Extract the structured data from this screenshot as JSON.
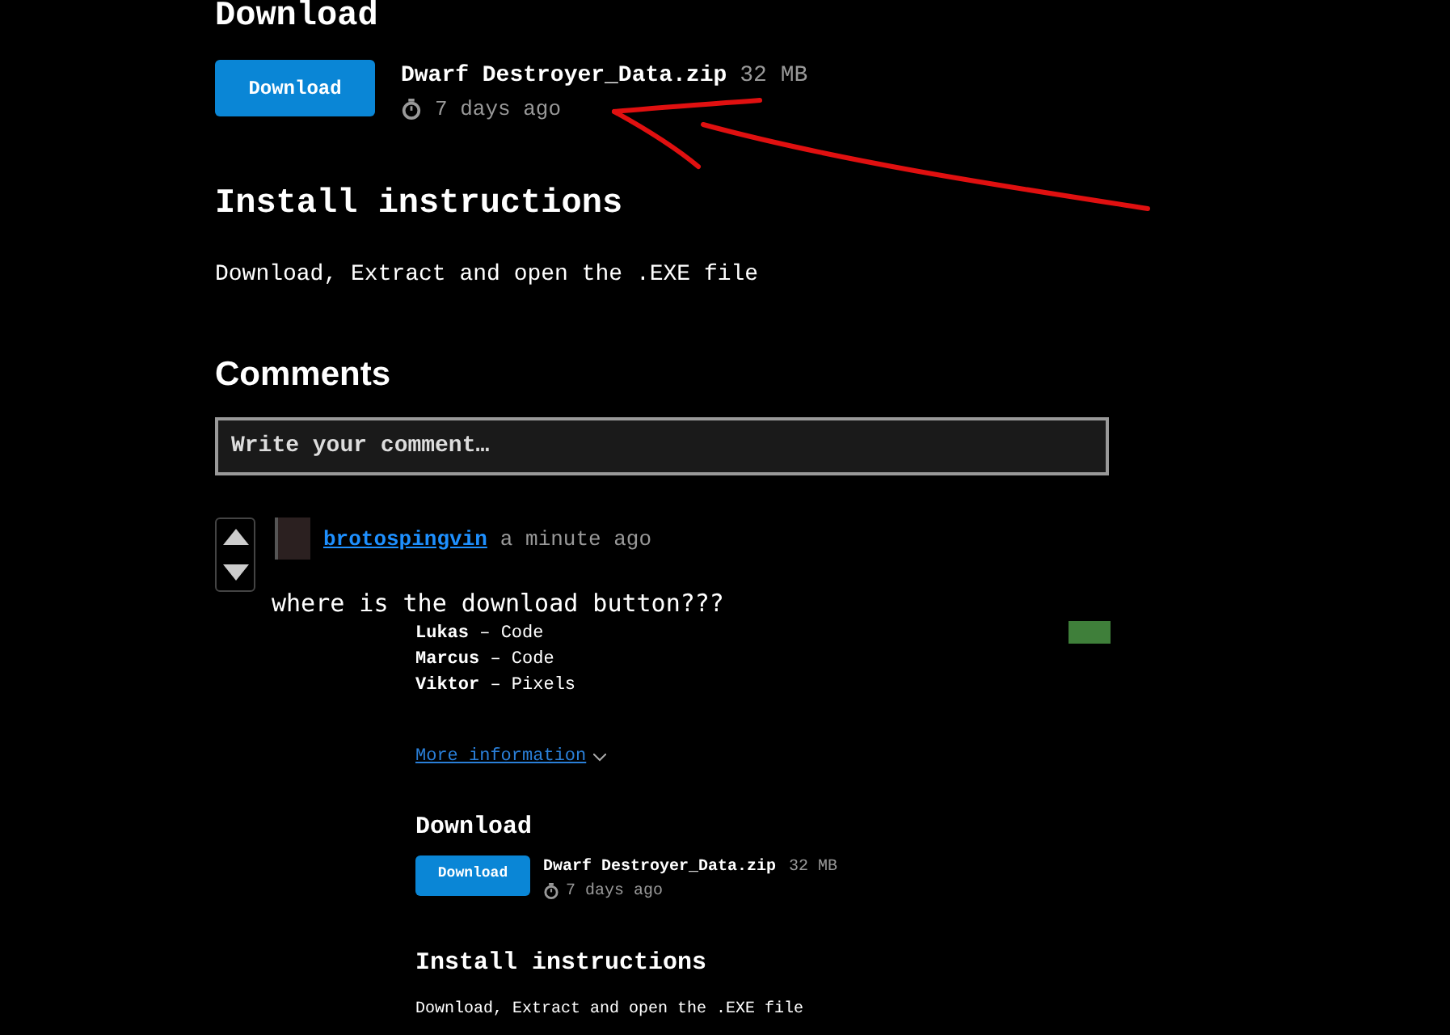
{
  "download_section": {
    "heading": "Download",
    "button": "Download",
    "file_name": "Dwarf Destroyer_Data.zip",
    "file_size": "32 MB",
    "time": "7 days ago"
  },
  "install": {
    "heading": "Install instructions",
    "text": "Download, Extract and open the .EXE file"
  },
  "comments": {
    "heading": "Comments",
    "placeholder": "Write your comment…",
    "items": [
      {
        "author": "brotospingvin",
        "time": "a minute ago",
        "body": "where is the download button???"
      }
    ]
  },
  "embedded_page": {
    "credits": [
      {
        "text": "**Lukas** – Code"
      },
      {
        "text": "**Marcus** – Code"
      },
      {
        "text": "**Viktor** – Pixels"
      }
    ],
    "more_link": "More information",
    "download": {
      "heading": "Download",
      "button": "Download",
      "file_name": "Dwarf Destroyer_Data.zip",
      "file_size": "32 MB",
      "time": "7 days ago"
    },
    "install": {
      "heading": "Install instructions",
      "text": "Download, Extract and open the .EXE file"
    }
  }
}
